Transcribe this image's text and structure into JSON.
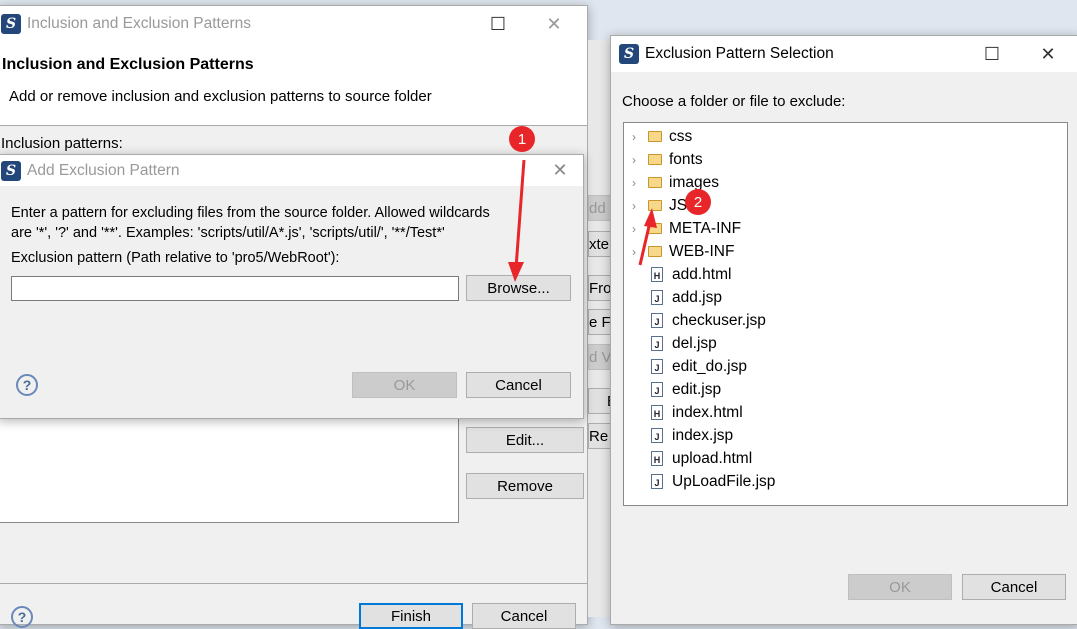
{
  "main_dialog": {
    "title": "Inclusion and Exclusion Patterns",
    "heading": "Inclusion and Exclusion Patterns",
    "description": "Add or remove inclusion and exclusion patterns to source folder",
    "inclusion_label": "Inclusion patterns:",
    "edit_label": "Edit...",
    "remove_label": "Remove",
    "finish_label": "Finish",
    "cancel_label": "Cancel"
  },
  "add_dialog": {
    "title": "Add Exclusion Pattern",
    "info_line1": "Enter a pattern for excluding files from the source folder. Allowed wildcards",
    "info_line2": "are '*', '?' and '**'. Examples: 'scripts/util/A*.js', 'scripts/util/', '**/Test*'",
    "field_label": "Exclusion pattern (Path relative to 'pro5/WebRoot'):",
    "field_value": "",
    "browse_label": "Browse...",
    "ok_label": "OK",
    "cancel_label": "Cancel"
  },
  "background_buttons": [
    "dd",
    "xte",
    "Fro",
    "e F",
    "d V",
    "E",
    "Re"
  ],
  "selection_dialog": {
    "title": "Exclusion Pattern Selection",
    "prompt": "Choose a folder or file to exclude:",
    "items": [
      {
        "name": "css",
        "type": "folder"
      },
      {
        "name": "fonts",
        "type": "folder"
      },
      {
        "name": "images",
        "type": "folder"
      },
      {
        "name": "JS",
        "type": "folder"
      },
      {
        "name": "META-INF",
        "type": "folder"
      },
      {
        "name": "WEB-INF",
        "type": "folder"
      },
      {
        "name": "add.html",
        "type": "html"
      },
      {
        "name": "add.jsp",
        "type": "jsp"
      },
      {
        "name": "checkuser.jsp",
        "type": "jsp"
      },
      {
        "name": "del.jsp",
        "type": "jsp"
      },
      {
        "name": "edit_do.jsp",
        "type": "jsp"
      },
      {
        "name": "edit.jsp",
        "type": "jsp"
      },
      {
        "name": "index.html",
        "type": "html"
      },
      {
        "name": "index.jsp",
        "type": "jsp"
      },
      {
        "name": "upload.html",
        "type": "html"
      },
      {
        "name": "UpLoadFile.jsp",
        "type": "jsp"
      }
    ],
    "ok_label": "OK",
    "cancel_label": "Cancel"
  },
  "annotations": {
    "step1": "1",
    "step2": "2",
    "color": "#e8262a"
  }
}
